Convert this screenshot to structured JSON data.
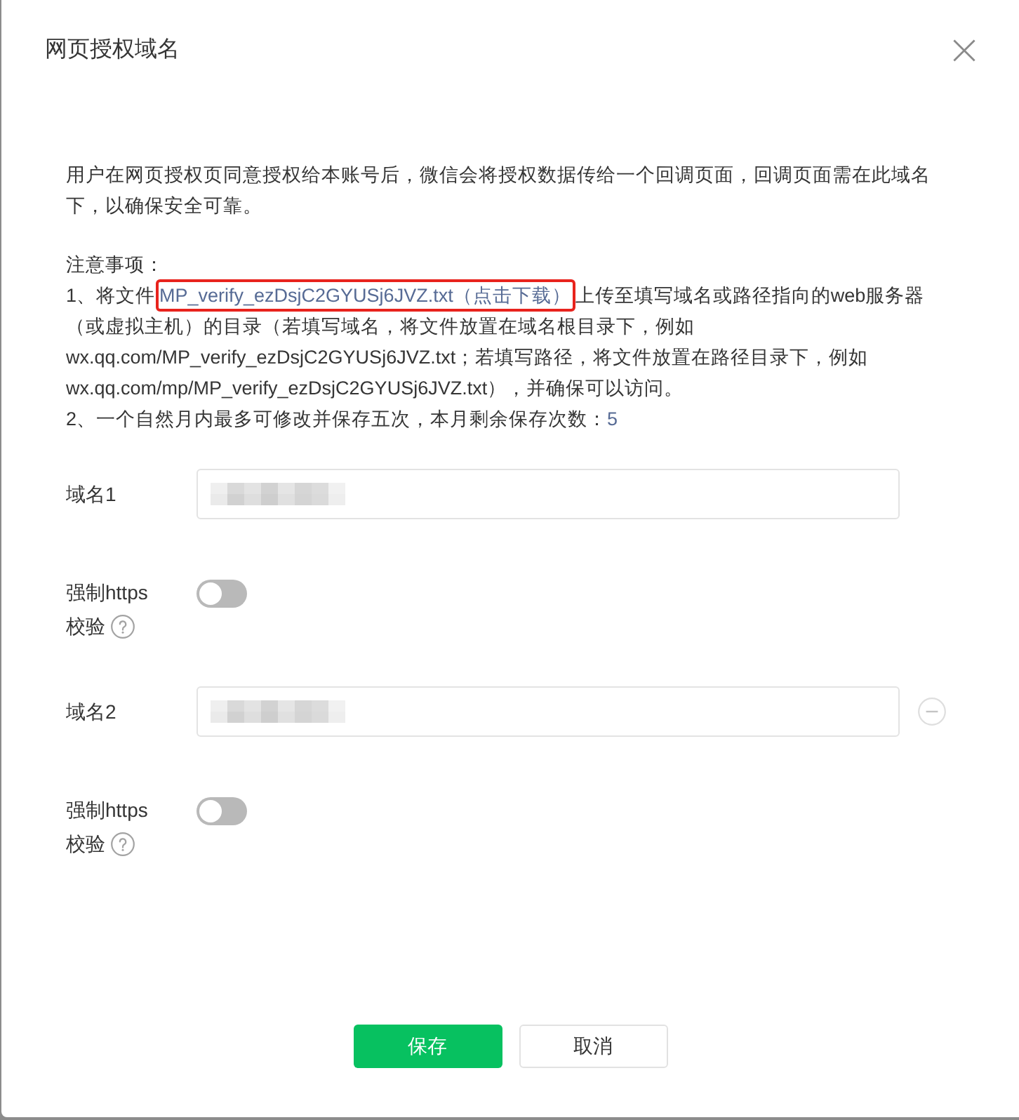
{
  "dialog": {
    "title": "网页授权域名"
  },
  "intro": "用户在网页授权页同意授权给本账号后，微信会将授权数据传给一个回调页面，回调页面需在此域名下，以确保安全可靠。",
  "notes": {
    "heading": "注意事项：",
    "items": [
      {
        "kind": "download",
        "before": "1、将文件",
        "link": {
          "text": "MP_verify_ezDsjC2GYUSj6JVZ.txt（点击下载）",
          "highlighted": true
        },
        "after": "上传至填写域名或路径指向的web服务器（或虚拟主机）的目录（若填写域名，将文件放置在域名根目录下，例如wx.qq.com/MP_verify_ezDsjC2GYUSj6JVZ.txt；若填写路径，将文件放置在路径目录下，例如wx.qq.com/mp/MP_verify_ezDsjC2GYUSj6JVZ.txt），并确保可以访问。"
      },
      {
        "kind": "count",
        "text": "2、一个自然月内最多可修改并保存五次，本月剩余保存次数：",
        "count": "5"
      }
    ]
  },
  "domains": [
    {
      "label": "域名1",
      "value_redacted": true,
      "removable": false,
      "https": {
        "label_lines": [
          "强制https",
          "校验"
        ],
        "on": false
      }
    },
    {
      "label": "域名2",
      "value_redacted": true,
      "removable": true,
      "https": {
        "label_lines": [
          "强制https",
          "校验"
        ],
        "on": false
      }
    }
  ],
  "buttons": [
    {
      "label": "保存",
      "kind": "primary"
    },
    {
      "label": "取消",
      "kind": "default"
    }
  ]
}
